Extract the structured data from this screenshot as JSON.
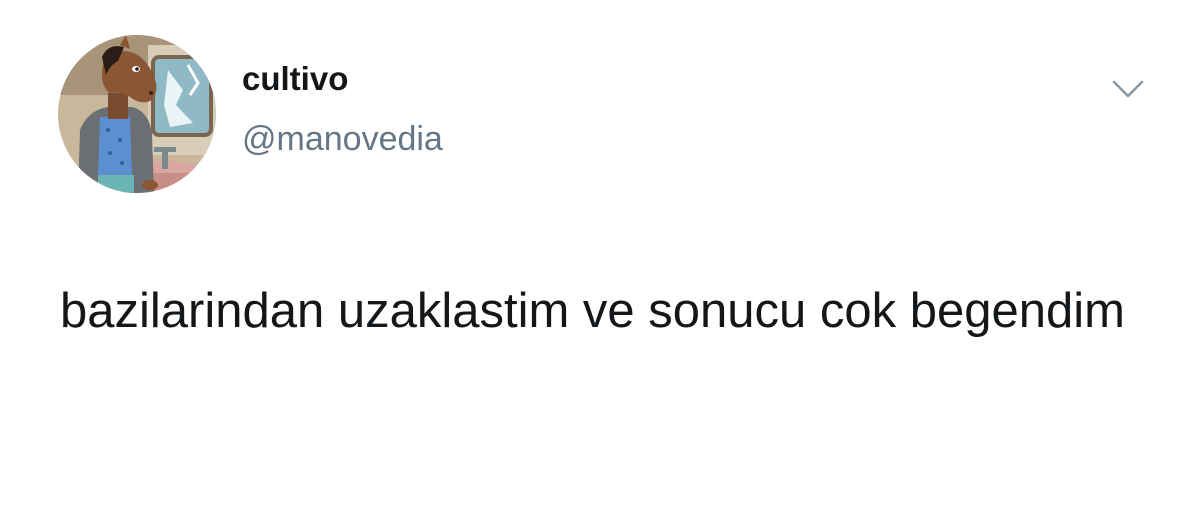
{
  "author": {
    "display_name": "cultivo",
    "handle": "@manovedia",
    "avatar_icon": "bojack-horseman-avatar"
  },
  "menu": {
    "icon": "chevron-down-icon"
  },
  "tweet": {
    "text": "bazilarindan uzaklastim ve sonucu cok begendim"
  },
  "colors": {
    "text": "#14171a",
    "secondary": "#657786",
    "caret": "#8899a6",
    "background": "#ffffff"
  }
}
